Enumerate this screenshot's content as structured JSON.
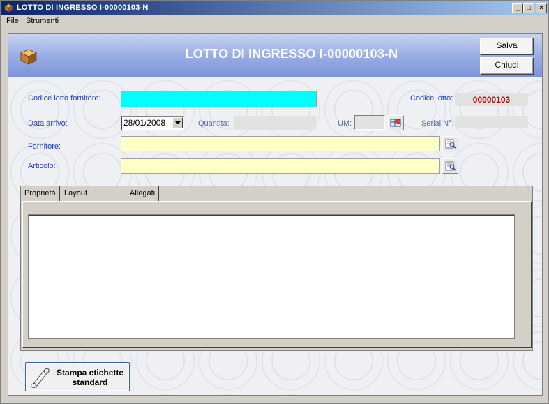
{
  "window": {
    "title": "LOTTO DI INGRESSO I-00000103-N",
    "minimize": "_",
    "maximize": "□",
    "close": "×"
  },
  "menu": {
    "items": [
      "File",
      "Strumenti"
    ]
  },
  "header": {
    "form_title": "LOTTO DI INGRESSO I-00000103-N",
    "save_label": "Salva",
    "close_label": "Chiudi",
    "icon": "box-icon"
  },
  "form": {
    "codice_lotto_fornitore_label": "Codice lotto fornitore:",
    "codice_lotto_fornitore_value": "",
    "codice_lotto_label": "Codice lotto:",
    "codice_lotto_value": "00000103",
    "data_arrivo_label": "Data arrivo:",
    "data_arrivo_value": "28/01/2008",
    "quantita_label": "Quantita:",
    "quantita_value": "",
    "um_label": "UM:",
    "um_value": "",
    "serial_label": "Serial N°:",
    "serial_value": "",
    "fornitore_label": "Fornitore:",
    "fornitore_value": "",
    "articolo_label": "Articolo:",
    "articolo_value": ""
  },
  "tabs": [
    {
      "label": "Proprietà",
      "active": true
    },
    {
      "label": "Layout di stampa",
      "active": false
    },
    {
      "label": "Allegati",
      "active": false
    }
  ],
  "footer": {
    "print_label_line1": "Stampa etichette",
    "print_label_line2": "standard"
  },
  "colors": {
    "required_field": "#00ffff",
    "lookup_field": "#ffffc8",
    "code_value": "#c00000",
    "label_text": "#1f3fbf"
  }
}
